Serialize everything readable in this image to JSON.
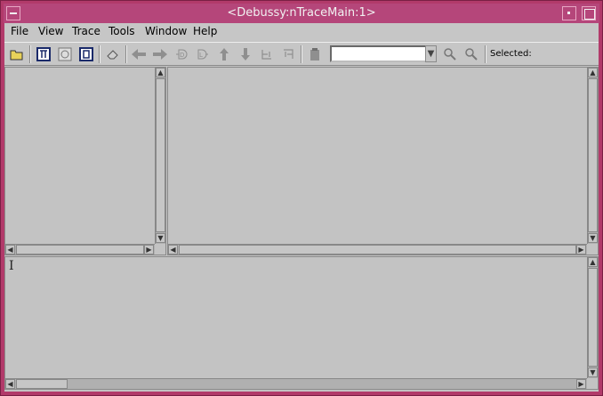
{
  "window": {
    "title": "<Debussy:nTraceMain:1>"
  },
  "menu": [
    {
      "label": "File"
    },
    {
      "label": "View"
    },
    {
      "label": "Trace"
    },
    {
      "label": "Tools"
    },
    {
      "label": "Window"
    },
    {
      "label": "Help"
    }
  ],
  "toolbar": {
    "combo_value": "",
    "selected_label": "Selected:"
  },
  "colors": {
    "titlebar": "#b5467a",
    "frame": "#b23a6a",
    "background": "#c3c3c3"
  }
}
